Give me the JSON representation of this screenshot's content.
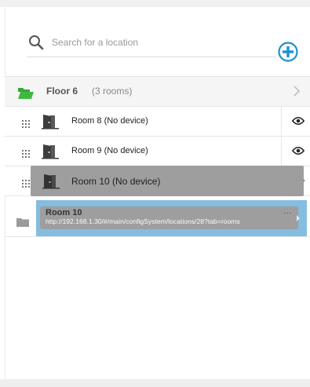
{
  "search": {
    "placeholder": "Search for a location"
  },
  "floor": {
    "name": "Floor 6",
    "count": "(3 rooms)"
  },
  "rooms": [
    {
      "label": "Room 8  (No device)"
    },
    {
      "label": "Room 9  (No device)"
    },
    {
      "label": "Room 10  (No device)"
    }
  ],
  "drag": {
    "label": "Room 10  (No device)",
    "tooltip_title": "Room 10",
    "tooltip_url": "http://192.168.1.30/#/main/configSystem/locations/28?tab=rooms",
    "tooltip_more": "..."
  },
  "colors": {
    "accent": "#1e90d0",
    "folder_open": "#3cab3c",
    "drop_target": "#84bde0",
    "drag_ghost": "#9e9e9e"
  }
}
